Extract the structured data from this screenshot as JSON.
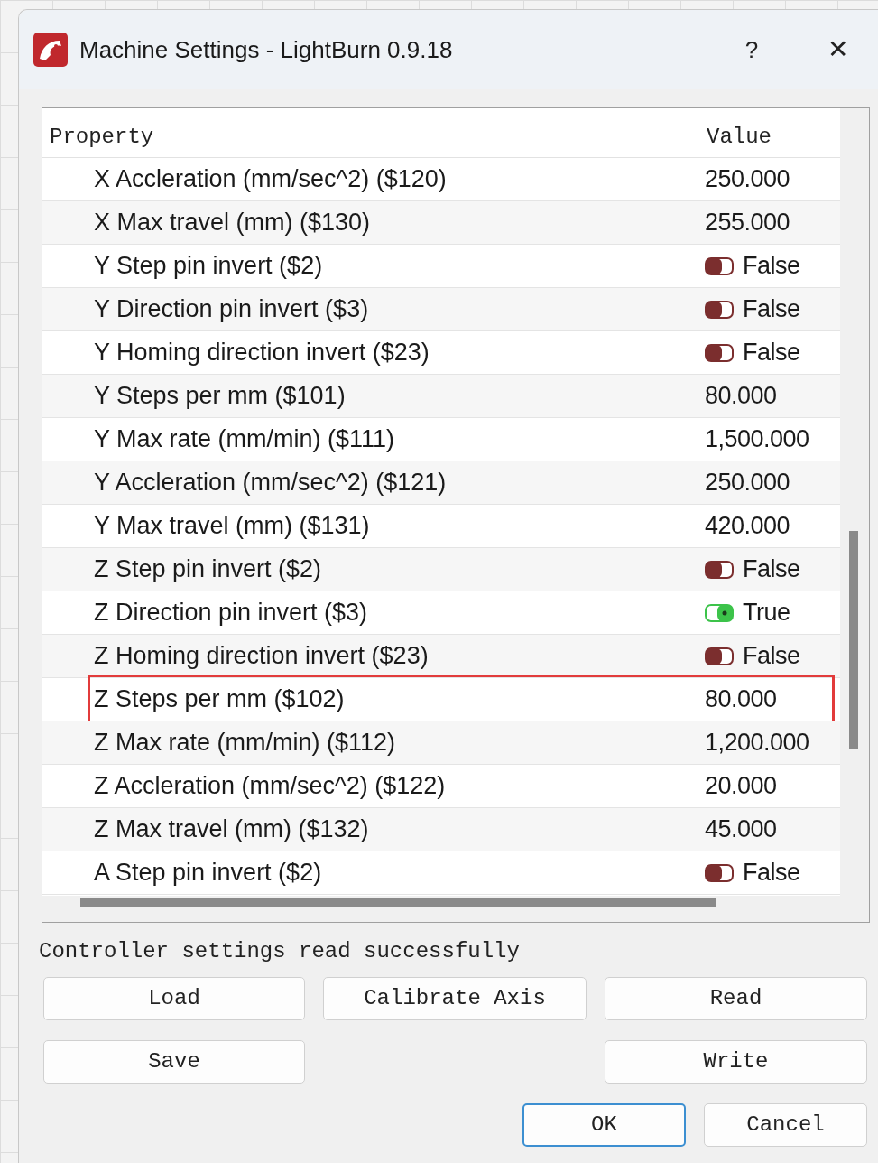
{
  "window": {
    "title": "Machine Settings - LightBurn 0.9.18",
    "help": "?",
    "close": "✕"
  },
  "table": {
    "columns": [
      "Property",
      "Value"
    ],
    "rows": [
      {
        "property": "X Accleration (mm/sec^2) ($120)",
        "kind": "number",
        "value": "250.000",
        "annotated": false
      },
      {
        "property": "X Max travel (mm) ($130)",
        "kind": "number",
        "value": "255.000",
        "annotated": false
      },
      {
        "property": "Y Step pin invert ($2)",
        "kind": "toggle",
        "on": false,
        "value": "False",
        "annotated": false
      },
      {
        "property": "Y Direction pin invert ($3)",
        "kind": "toggle",
        "on": false,
        "value": "False",
        "annotated": false
      },
      {
        "property": "Y Homing direction invert ($23)",
        "kind": "toggle",
        "on": false,
        "value": "False",
        "annotated": false
      },
      {
        "property": "Y Steps per mm ($101)",
        "kind": "number",
        "value": "80.000",
        "annotated": false
      },
      {
        "property": "Y Max rate (mm/min) ($111)",
        "kind": "number",
        "value": "1,500.000",
        "annotated": false
      },
      {
        "property": "Y Accleration (mm/sec^2) ($121)",
        "kind": "number",
        "value": "250.000",
        "annotated": false
      },
      {
        "property": "Y Max travel (mm) ($131)",
        "kind": "number",
        "value": "420.000",
        "annotated": false
      },
      {
        "property": "Z Step pin invert ($2)",
        "kind": "toggle",
        "on": false,
        "value": "False",
        "annotated": false
      },
      {
        "property": "Z Direction pin invert ($3)",
        "kind": "toggle",
        "on": true,
        "value": "True",
        "annotated": false
      },
      {
        "property": "Z Homing direction invert ($23)",
        "kind": "toggle",
        "on": false,
        "value": "False",
        "annotated": false
      },
      {
        "property": "Z Steps per mm ($102)",
        "kind": "number",
        "value": "80.000",
        "annotated": true
      },
      {
        "property": "Z Max rate (mm/min) ($112)",
        "kind": "number",
        "value": "1,200.000",
        "annotated": false
      },
      {
        "property": "Z Accleration (mm/sec^2) ($122)",
        "kind": "number",
        "value": "20.000",
        "annotated": false
      },
      {
        "property": "Z Max travel (mm) ($132)",
        "kind": "number",
        "value": "45.000",
        "annotated": false
      },
      {
        "property": "A Step pin invert ($2)",
        "kind": "toggle",
        "on": false,
        "value": "False",
        "annotated": false
      }
    ]
  },
  "status": "Controller settings read successfully",
  "buttons": [
    {
      "label": "Load",
      "focused": false
    },
    {
      "label": "Calibrate Axis",
      "focused": false
    },
    {
      "label": "Read",
      "focused": false
    },
    {
      "label": "Save",
      "focused": false
    },
    {
      "label": "Write",
      "focused": false
    },
    {
      "label": "OK",
      "focused": true
    },
    {
      "label": "Cancel",
      "focused": false
    }
  ]
}
